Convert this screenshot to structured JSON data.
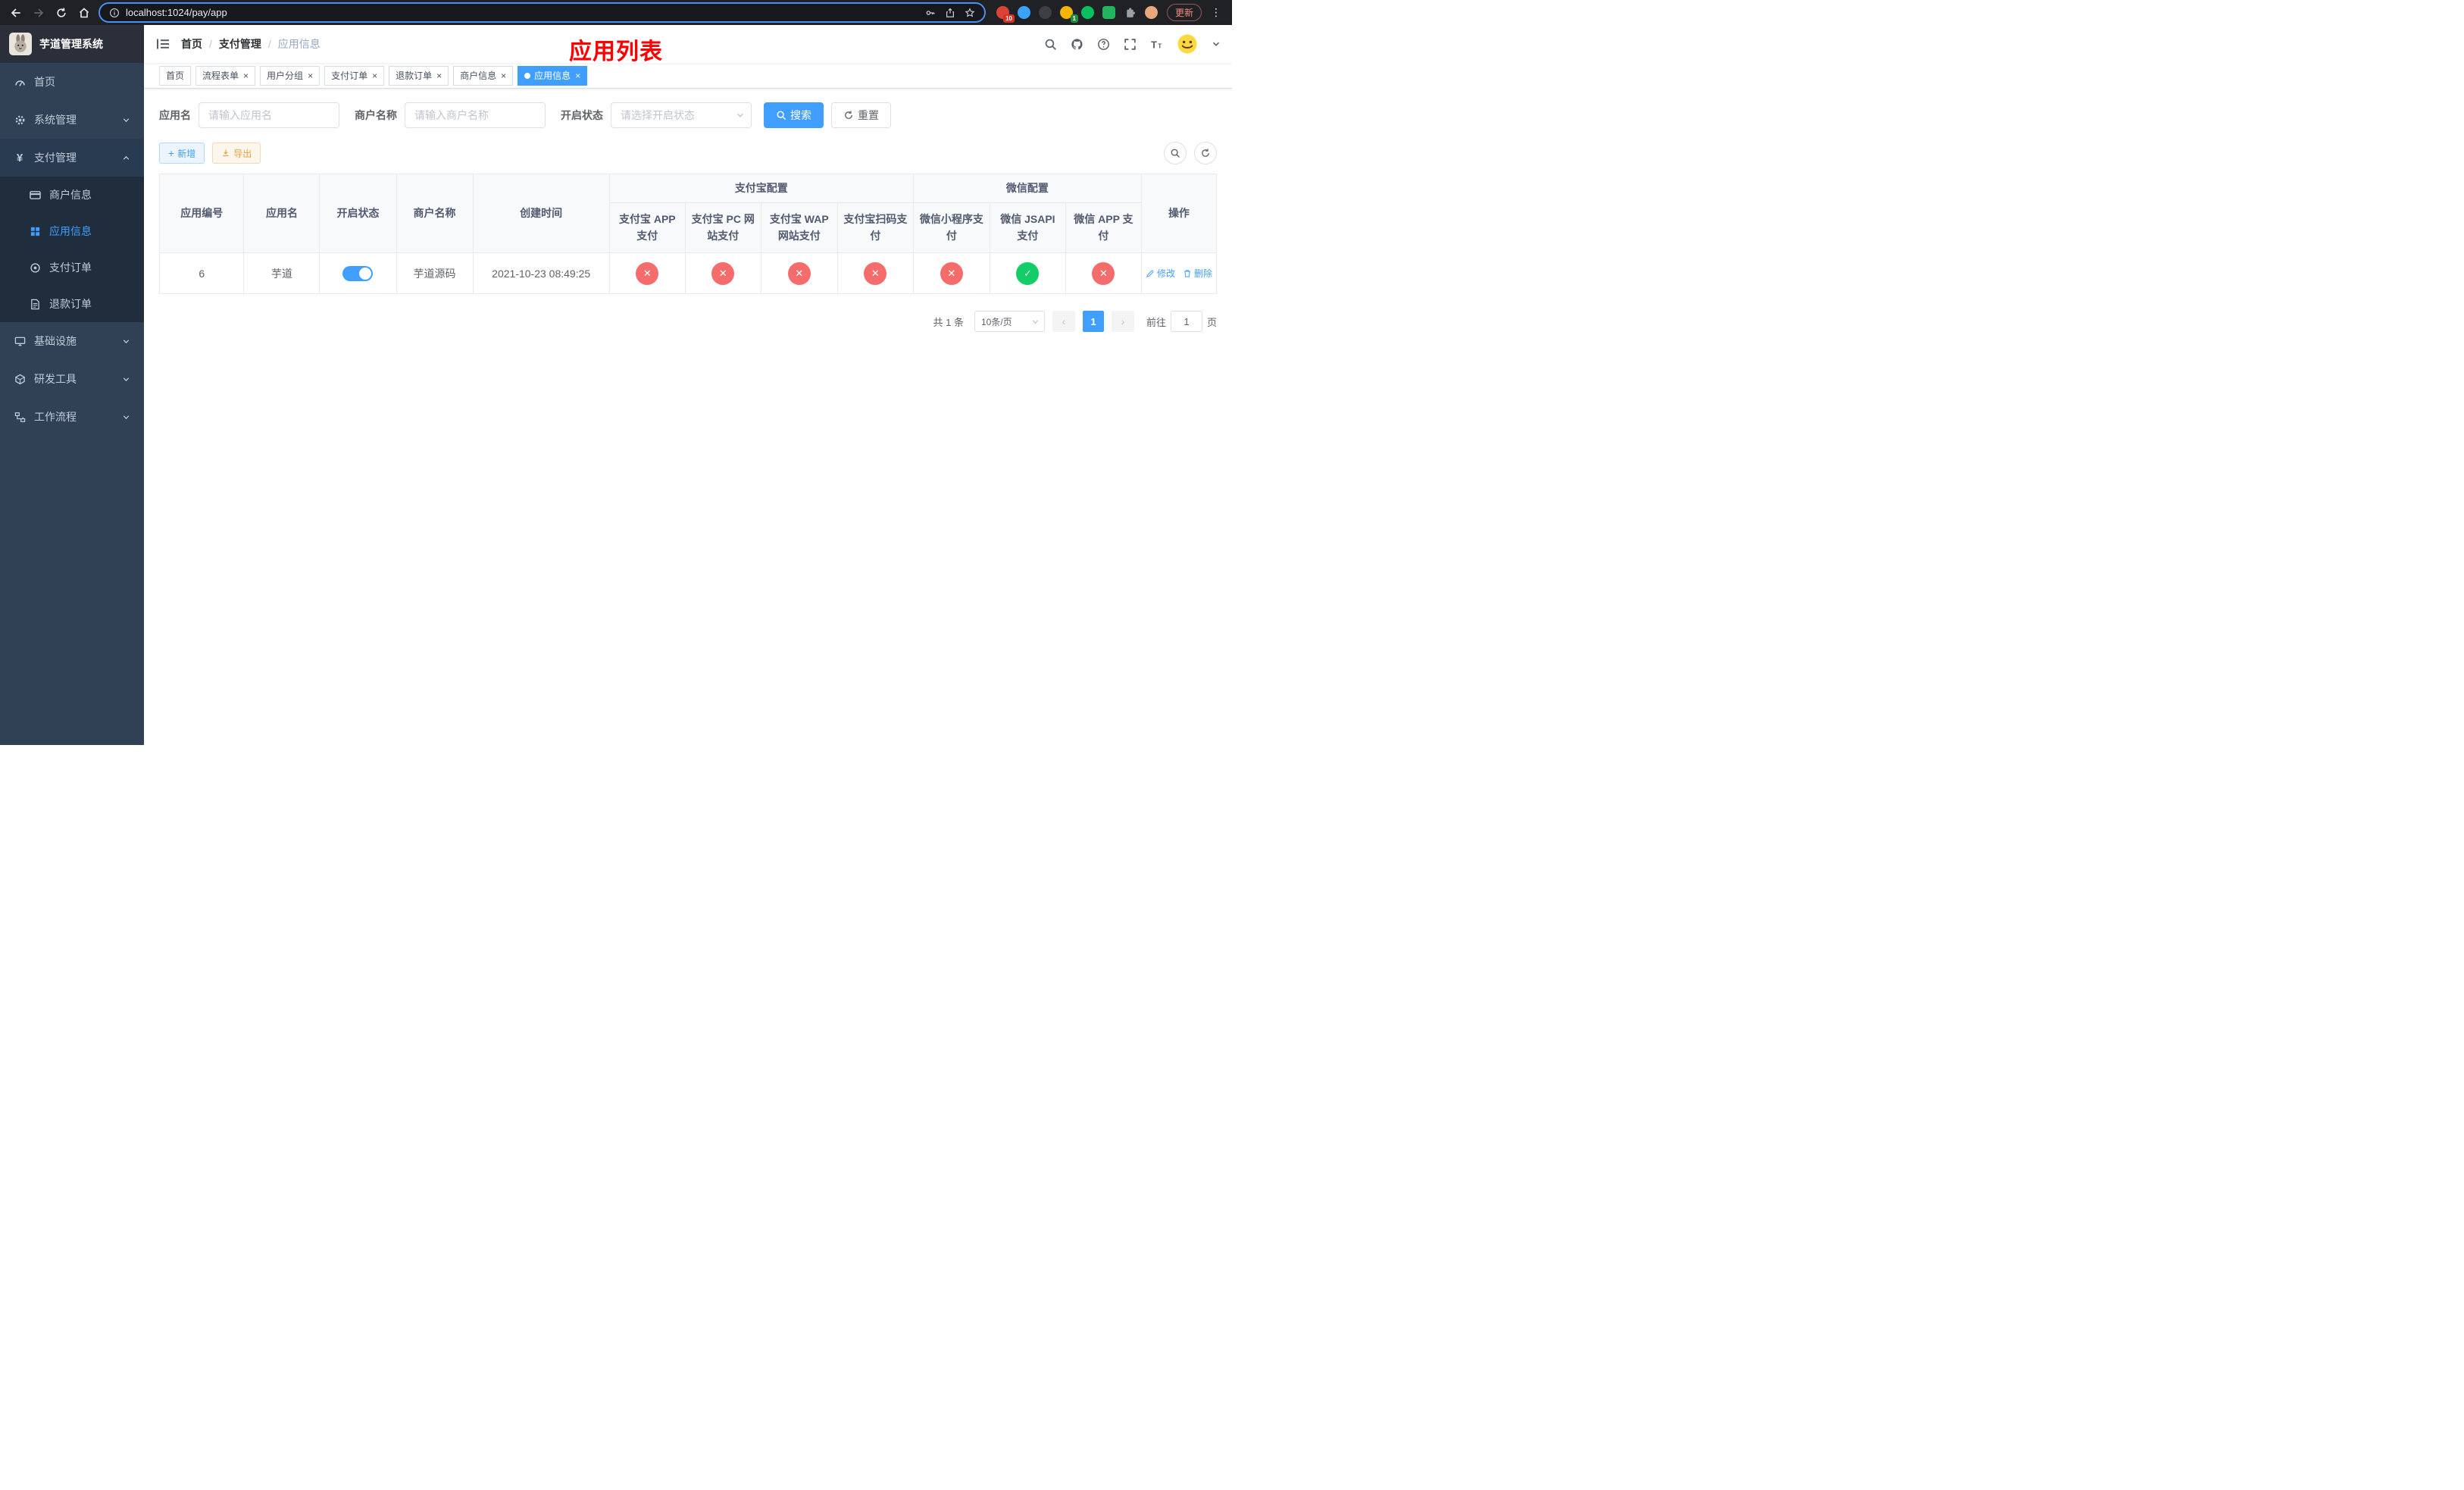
{
  "colors": {
    "accent": "#409eff",
    "success": "#13ce66",
    "danger": "#f56c6c",
    "warning": "#e6a23c",
    "annotation": "#ff0000",
    "sidebar_bg": "#304156"
  },
  "browser": {
    "url": "localhost:1024/pay/app",
    "update_label": "更新",
    "ext_badge_red": "10",
    "ext_badge_green": "1"
  },
  "sidebar": {
    "logo_title": "芋道管理系统",
    "menu": [
      {
        "label": "首页"
      },
      {
        "label": "系统管理"
      },
      {
        "label": "支付管理"
      },
      {
        "label": "商户信息"
      },
      {
        "label": "应用信息"
      },
      {
        "label": "支付订单"
      },
      {
        "label": "退款订单"
      },
      {
        "label": "基础设施"
      },
      {
        "label": "研发工具"
      },
      {
        "label": "工作流程"
      }
    ]
  },
  "header": {
    "breadcrumb": [
      "首页",
      "支付管理",
      "应用信息"
    ],
    "overlay_title": "应用列表"
  },
  "tabs": [
    {
      "label": "首页",
      "closable": false,
      "active": false
    },
    {
      "label": "流程表单",
      "closable": true,
      "active": false
    },
    {
      "label": "用户分组",
      "closable": true,
      "active": false
    },
    {
      "label": "支付订单",
      "closable": true,
      "active": false
    },
    {
      "label": "退款订单",
      "closable": true,
      "active": false
    },
    {
      "label": "商户信息",
      "closable": true,
      "active": false
    },
    {
      "label": "应用信息",
      "closable": true,
      "active": true
    }
  ],
  "filters": {
    "app_name_label": "应用名",
    "app_name_placeholder": "请输入应用名",
    "merchant_label": "商户名称",
    "merchant_placeholder": "请输入商户名称",
    "status_label": "开启状态",
    "status_placeholder": "请选择开启状态",
    "search_label": "搜索",
    "reset_label": "重置"
  },
  "toolbar": {
    "add_label": "新增",
    "export_label": "导出"
  },
  "table": {
    "columns": {
      "app_id": "应用编号",
      "app_name": "应用名",
      "status": "开启状态",
      "merchant": "商户名称",
      "created": "创建时间",
      "alipay_group": "支付宝配置",
      "wechat_group": "微信配置",
      "actions": "操作"
    },
    "subcolumns": [
      "支付宝 APP 支付",
      "支付宝 PC 网站支付",
      "支付宝 WAP 网站支付",
      "支付宝扫码支付",
      "微信小程序支付",
      "微信 JSAPI 支付",
      "微信 APP 支付"
    ],
    "row": {
      "app_id": "6",
      "app_name": "芋道",
      "enabled": true,
      "merchant": "芋道源码",
      "created": "2021-10-23 08:49:25",
      "channels": [
        "fail",
        "fail",
        "fail",
        "fail",
        "fail",
        "success",
        "fail"
      ],
      "edit_label": "修改",
      "delete_label": "删除"
    }
  },
  "pagination": {
    "total_text": "共 1 条",
    "page_size": "10条/页",
    "current_page": "1",
    "goto_prefix": "前往",
    "goto_value": "1",
    "goto_suffix": "页"
  }
}
